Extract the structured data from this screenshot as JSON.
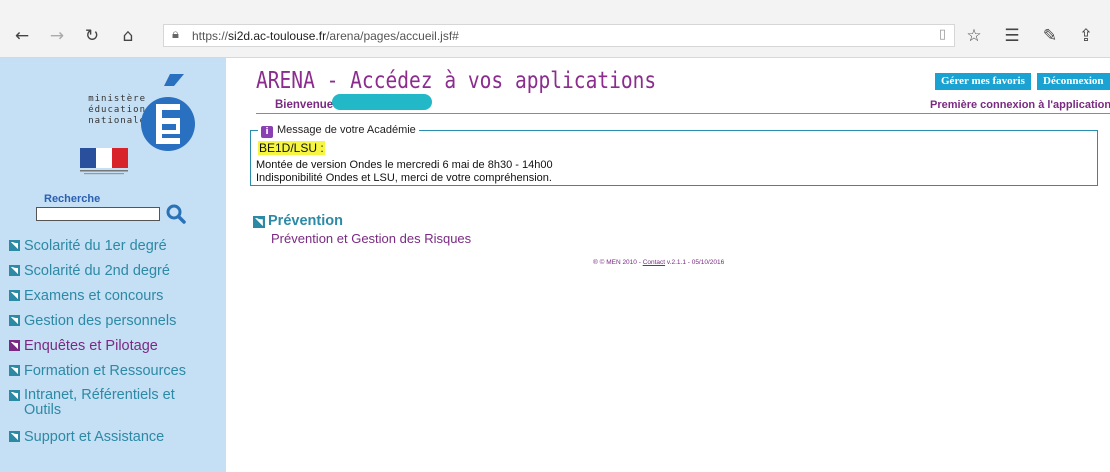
{
  "browser": {
    "url_prefix": "https://",
    "url_host": "si2d.ac-toulouse.fr",
    "url_path": "/arena/pages/accueil.jsf#",
    "icons": [
      "back-icon",
      "forward-icon",
      "refresh-icon",
      "home-icon",
      "lock-icon",
      "reading-view-icon",
      "favorite-star-icon",
      "favorites-list-icon",
      "pen-icon",
      "share-icon"
    ]
  },
  "sidebar": {
    "logo_lines": [
      "ministère",
      "éducation",
      "nationale"
    ],
    "search_label": "Recherche",
    "search_value": "",
    "items": [
      {
        "label": "Scolarité du 1er degré",
        "active": false
      },
      {
        "label": "Scolarité du 2nd degré",
        "active": false
      },
      {
        "label": "Examens et concours",
        "active": false
      },
      {
        "label": "Gestion des personnels",
        "active": false
      },
      {
        "label": "Enquêtes et Pilotage",
        "active": true
      },
      {
        "label": "Formation et Ressources",
        "active": false
      },
      {
        "label": "Intranet, Référentiels et",
        "label2": "Outils",
        "active": false
      },
      {
        "label": "Support et Assistance",
        "active": false
      }
    ]
  },
  "header": {
    "title": "ARENA - Accédez à vos applications",
    "favorites_button": "Gérer mes favoris",
    "logout_button": "Déconnexion",
    "welcome": "Bienvenue",
    "first_login_link": "Première connexion à l'application"
  },
  "message": {
    "legend": "Message de votre Académie",
    "tag": "BE1D/LSU :",
    "line1": "Montée de version Ondes le mercredi 6 mai de 8h30 - 14h00",
    "line2": "Indisponibilité Ondes et LSU, merci de votre compréhension."
  },
  "section": {
    "title": "Prévention",
    "link": "Prévention et Gestion des Risques"
  },
  "footer": {
    "copyright": "® © MEN 2010 - ",
    "contact": "Contact",
    "version": " v.2.1.1 - 05/10/2016"
  },
  "colors": {
    "sidebar_bg": "#c5dff4",
    "accent_teal": "#2c8aa5",
    "accent_purple": "#7a2a82",
    "button_bg": "#1aa3d2",
    "highlight": "#f6f642"
  }
}
